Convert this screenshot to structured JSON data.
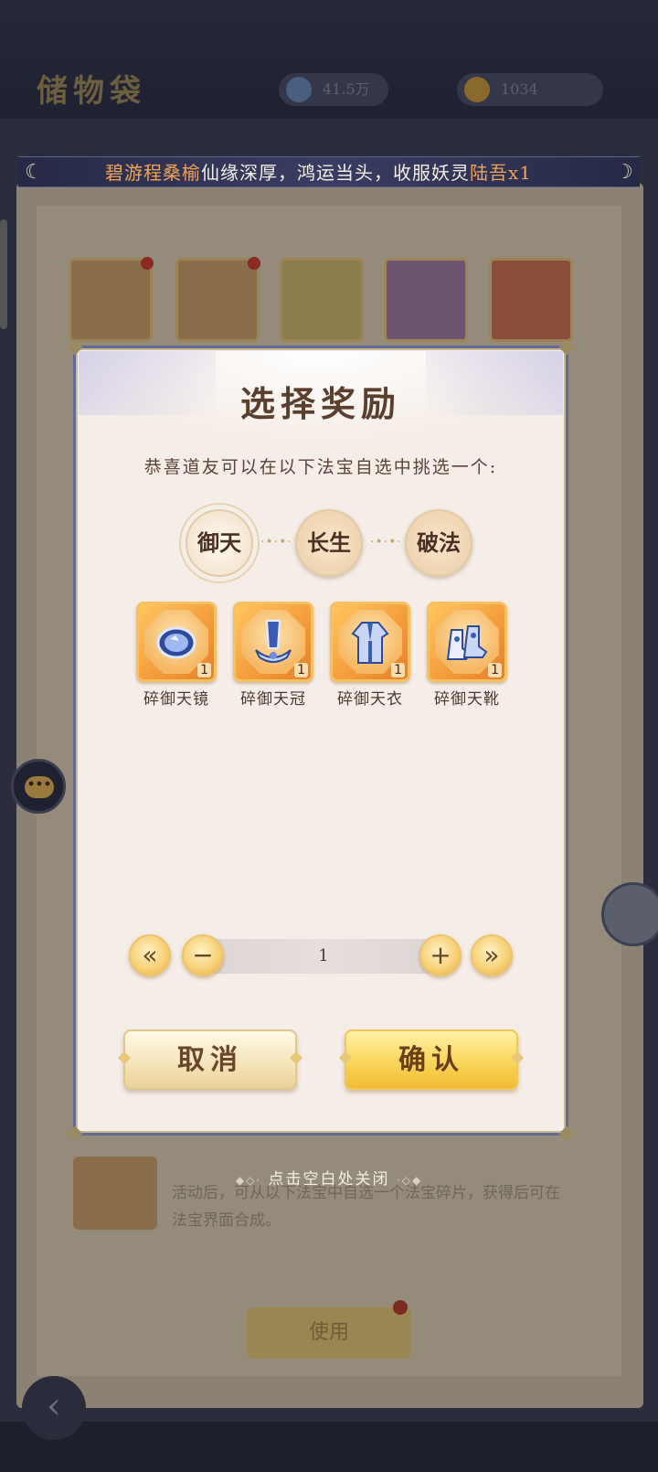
{
  "background": {
    "page_title": "储物袋",
    "resource_1": "41.5万",
    "resource_2": "1034",
    "use_button": "使用",
    "description": "活动后，可从以下法宝中自选一个法宝碎片，获得后可在法宝界面合成。"
  },
  "banner": {
    "player_name": "碧游程桑榆",
    "message": "仙缘深厚，鸿运当头，收服妖灵",
    "spirit_name": "陆吾",
    "count": "x1"
  },
  "modal": {
    "title": "选择奖励",
    "subtitle": "恭喜道友可以在以下法宝自选中挑选一个:",
    "tabs": [
      {
        "label": "御天",
        "selected": true
      },
      {
        "label": "长生",
        "selected": false
      },
      {
        "label": "破法",
        "selected": false
      }
    ],
    "items": [
      {
        "name": "碎御天镜",
        "qty": "1",
        "icon": "mirror-icon"
      },
      {
        "name": "碎御天冠",
        "qty": "1",
        "icon": "crown-icon"
      },
      {
        "name": "碎御天衣",
        "qty": "1",
        "icon": "robe-icon"
      },
      {
        "name": "碎御天靴",
        "qty": "1",
        "icon": "boots-icon"
      }
    ],
    "stepper": {
      "first": "«",
      "minus": "−",
      "value": "1",
      "plus": "+",
      "last": "»"
    },
    "cancel_label": "取消",
    "confirm_label": "确认"
  },
  "close_hint": "点击空白处关闭",
  "colors": {
    "accent_gold": "#f9d65a",
    "item_orange": "#f39a3a",
    "banner_highlight": "#f0a35a",
    "modal_bg": "#f5ede7"
  }
}
